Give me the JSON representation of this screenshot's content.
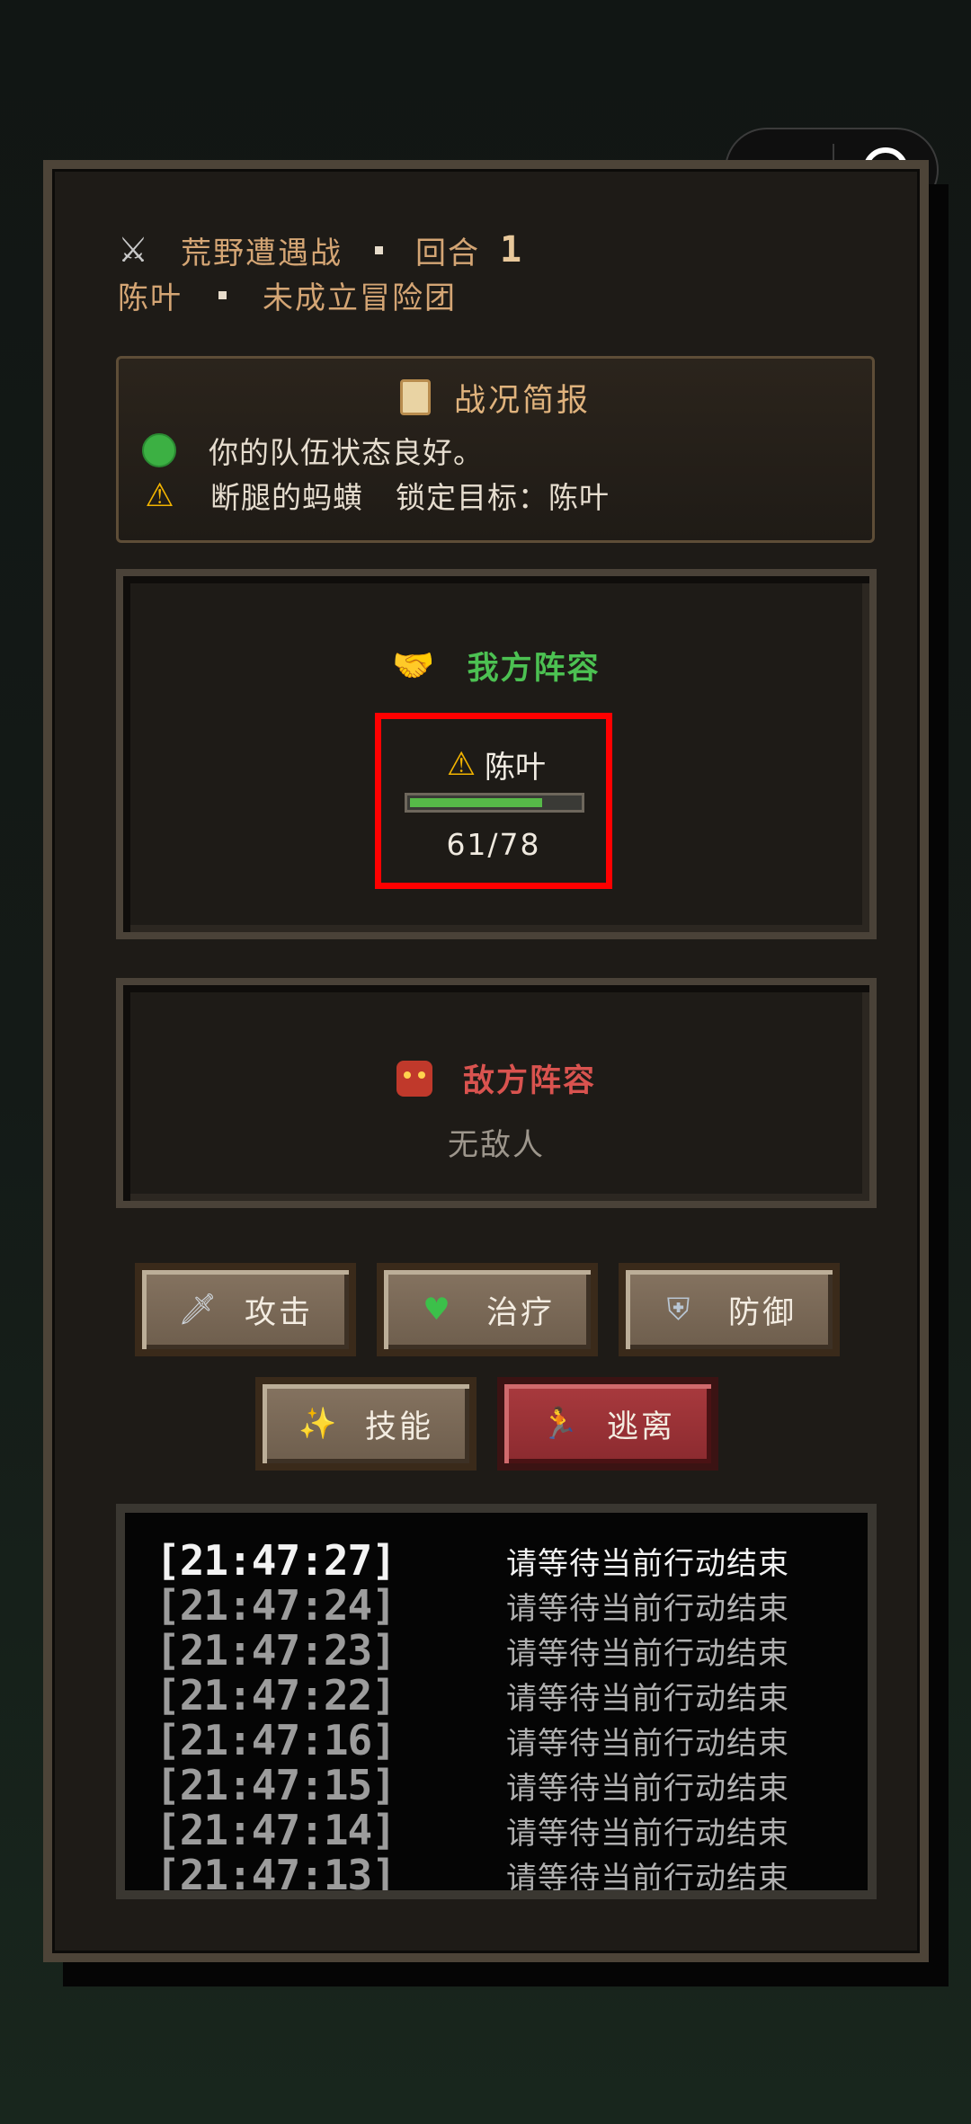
{
  "header": {
    "battle_title": "荒野遭遇战",
    "round_label": "回合",
    "round_number": "1",
    "player_name": "陈叶",
    "guild_status": "未成立冒险团"
  },
  "report": {
    "title": "战况简报",
    "status_line": "你的队伍状态良好。",
    "threat_enemy": "断腿的蚂蟥",
    "threat_target": "锁定目标：陈叶"
  },
  "ally_panel": {
    "title": "我方阵容",
    "members": [
      {
        "name": "陈叶",
        "hp_text": "61/78",
        "hp_fraction": 0.78
      }
    ]
  },
  "enemy_panel": {
    "title": "敌方阵容",
    "empty_text": "无敌人"
  },
  "actions": {
    "attack": "攻击",
    "heal": "治疗",
    "defend": "防御",
    "skill": "技能",
    "flee": "逃离"
  },
  "log": [
    {
      "time": "[21:47:27]",
      "msg": "请等待当前行动结束"
    },
    {
      "time": "[21:47:24]",
      "msg": "请等待当前行动结束"
    },
    {
      "time": "[21:47:23]",
      "msg": "请等待当前行动结束"
    },
    {
      "time": "[21:47:22]",
      "msg": "请等待当前行动结束"
    },
    {
      "time": "[21:47:16]",
      "msg": "请等待当前行动结束"
    },
    {
      "time": "[21:47:15]",
      "msg": "请等待当前行动结束"
    },
    {
      "time": "[21:47:14]",
      "msg": "请等待当前行动结束"
    },
    {
      "time": "[21:47:13]",
      "msg": "请等待当前行动结束"
    }
  ],
  "colors": {
    "ally_title": "#4cc152",
    "enemy_title": "#d9534f",
    "hp_fill": "#56b948",
    "highlight": "#ff0000"
  },
  "icons": {
    "battle": "crossed-swords-icon",
    "report": "scroll-icon",
    "status_ok": "green-circle-icon",
    "threat": "warning-icon",
    "ally": "handshake-icon",
    "enemy": "demon-mask-icon",
    "attack": "dagger-icon",
    "heal": "green-heart-icon",
    "defend": "shield-icon",
    "skill": "sparkles-icon",
    "flee": "running-person-icon"
  }
}
